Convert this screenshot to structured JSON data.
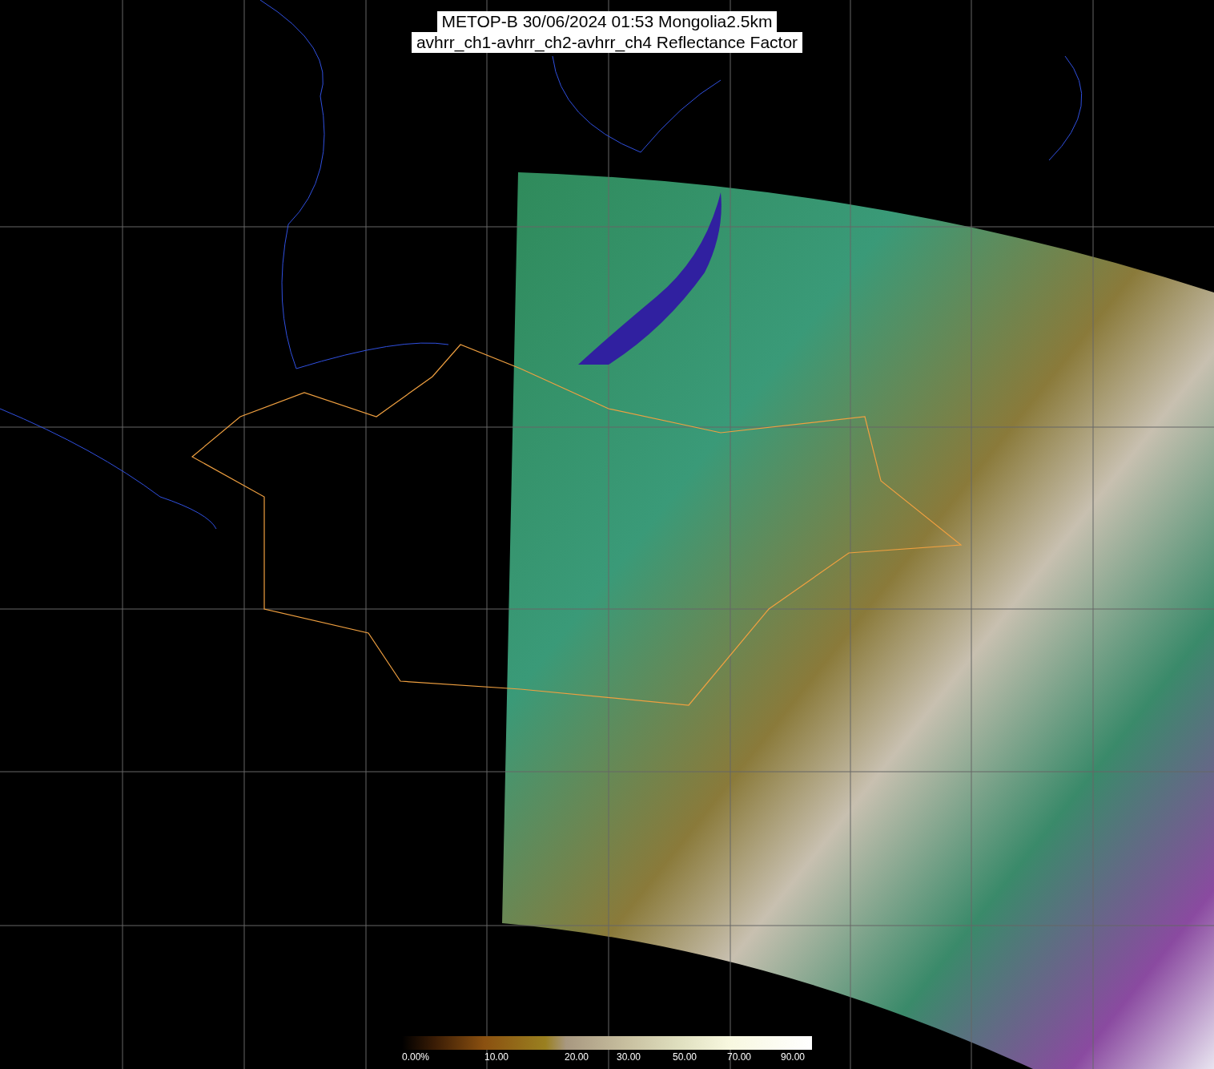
{
  "title": {
    "lines": [
      "METOP-B 30/06/2024 01:53 Mongolia2.5km",
      "avhrr_ch1-avhrr_ch2-avhrr_ch4 Reflectance Factor"
    ]
  },
  "colorbar": {
    "labels": [
      "0.00%",
      "10.00",
      "20.00",
      "30.00",
      "50.00",
      "70.00",
      "90.00"
    ]
  }
}
